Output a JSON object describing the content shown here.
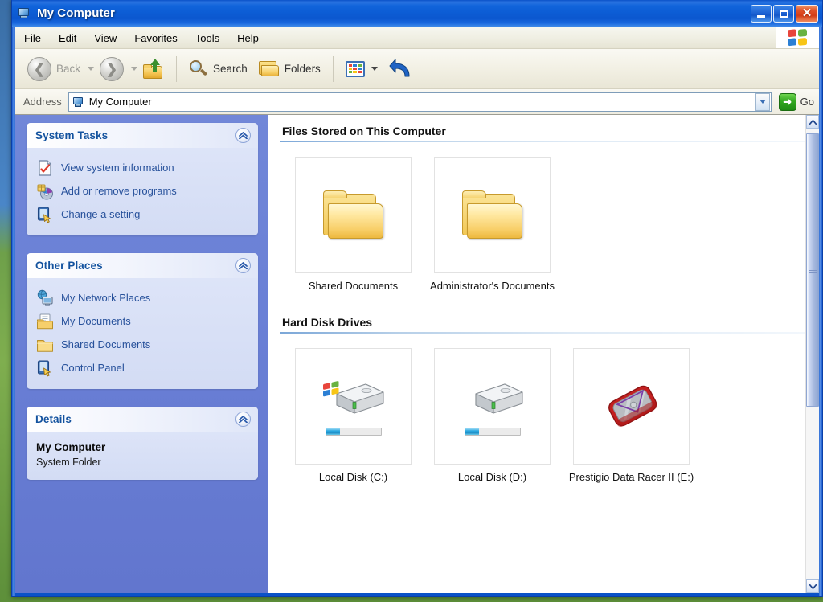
{
  "window": {
    "title": "My Computer",
    "title_icon": "my-computer-icon",
    "controls": {
      "minimize": "_",
      "maximize": "□",
      "close": "✕"
    }
  },
  "menubar": {
    "items": [
      "File",
      "Edit",
      "View",
      "Favorites",
      "Tools",
      "Help"
    ],
    "brand_icon": "windows-flag-icon"
  },
  "toolbar": {
    "back": "Back",
    "forward": "",
    "up": "",
    "search": "Search",
    "folders": "Folders",
    "views": "",
    "undo": ""
  },
  "address": {
    "label": "Address",
    "value": "My Computer",
    "icon": "my-computer-icon",
    "go_label": "Go",
    "go_glyph": "➜"
  },
  "sidebar": {
    "panels": [
      {
        "title": "System Tasks",
        "items": [
          {
            "label": "View system information",
            "icon": "system-info-icon"
          },
          {
            "label": "Add or remove programs",
            "icon": "add-remove-programs-icon"
          },
          {
            "label": "Change a setting",
            "icon": "control-panel-icon"
          }
        ]
      },
      {
        "title": "Other Places",
        "items": [
          {
            "label": "My Network Places",
            "icon": "network-places-icon"
          },
          {
            "label": "My Documents",
            "icon": "my-documents-icon"
          },
          {
            "label": "Shared Documents",
            "icon": "shared-documents-icon"
          },
          {
            "label": "Control Panel",
            "icon": "control-panel-icon"
          }
        ]
      }
    ],
    "details": {
      "title": "Details",
      "name": "My Computer",
      "type": "System Folder"
    }
  },
  "content": {
    "sections": [
      {
        "title": "Files Stored on This Computer",
        "items": [
          {
            "label": "Shared Documents",
            "icon": "folder-icon"
          },
          {
            "label": "Administrator's Documents",
            "icon": "folder-icon"
          }
        ]
      },
      {
        "title": "Hard Disk Drives",
        "items": [
          {
            "label": "Local Disk (C:)",
            "icon": "system-drive-icon",
            "used_percent": 25
          },
          {
            "label": "Local Disk (D:)",
            "icon": "drive-icon",
            "used_percent": 25
          },
          {
            "label": "Prestigio Data Racer II (E:)",
            "icon": "external-drive-icon"
          }
        ]
      }
    ]
  },
  "colors": {
    "titlebar_blue": "#0b57cf",
    "sidebar_blue": "#6a80d6",
    "panel_header_text": "#14539f",
    "link_blue": "#27519b",
    "go_green": "#33a820",
    "close_red": "#d33c16",
    "capacity_blue": "#2aa8e0"
  }
}
